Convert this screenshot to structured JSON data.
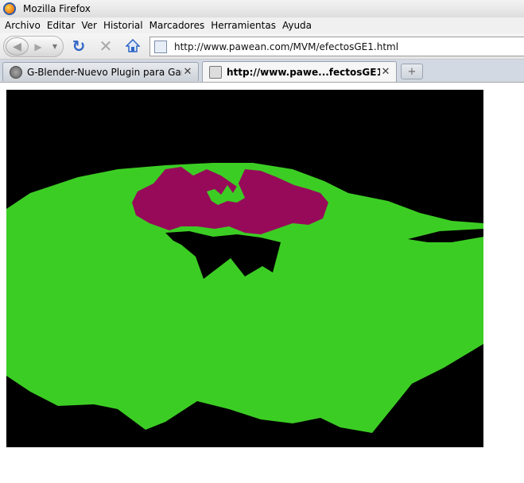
{
  "window": {
    "title": "Mozilla Firefox"
  },
  "menu": [
    "Archivo",
    "Editar",
    "Ver",
    "Historial",
    "Marcadores",
    "Herramientas",
    "Ayuda"
  ],
  "address_bar": {
    "url": "http://www.pawean.com/MVM/efectosGE1.html"
  },
  "tabs": [
    {
      "label": "G-Blender-Nuevo Plugin para Gam...",
      "active": false
    },
    {
      "label": "http://www.pawe...fectosGE1.html",
      "active": true
    }
  ],
  "icons": {
    "back": "back-arrow-icon",
    "forward": "forward-arrow-icon",
    "reload": "reload-icon",
    "stop": "stop-icon",
    "home": "home-icon",
    "new_tab": "plus-icon",
    "close": "close-icon"
  },
  "colors": {
    "ground_green": "#3ccd24",
    "flower_magenta": "#970a5a",
    "canvas_black": "#000000",
    "reload_blue": "#2f66c6"
  }
}
